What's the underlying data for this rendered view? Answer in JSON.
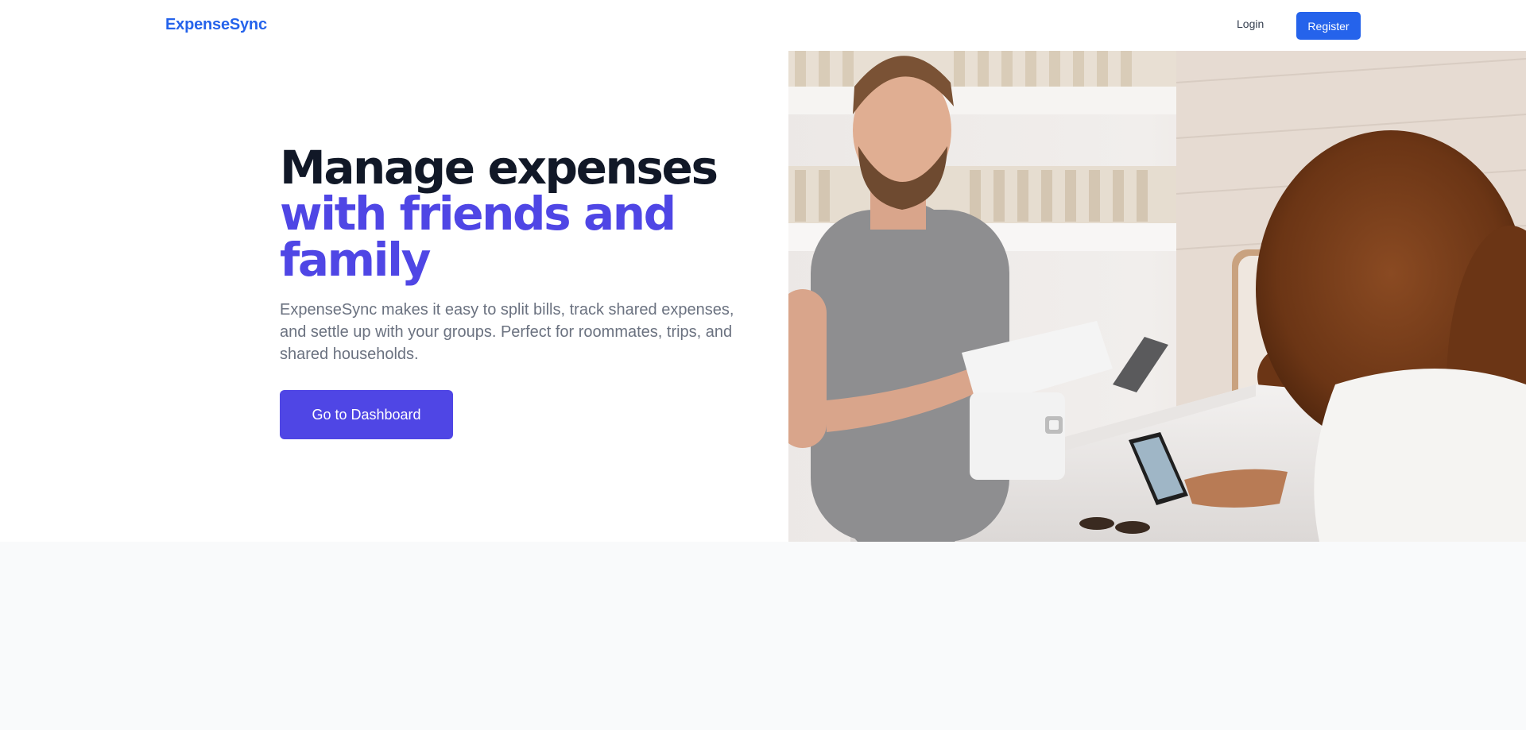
{
  "brand": "ExpenseSync",
  "nav": {
    "login": "Login",
    "register": "Register"
  },
  "hero": {
    "headline_line1": "Manage expenses",
    "headline_line2": "with friends and family",
    "description": "ExpenseSync makes it easy to split bills, track shared expenses, and settle up with your groups. Perfect for roommates, trips, and shared households.",
    "cta": "Go to Dashboard"
  },
  "colors": {
    "brand": "#2563eb",
    "accent": "#4f46e5",
    "heading": "#111827",
    "body_text": "#6b7280",
    "page_bg": "#f9fafb"
  }
}
